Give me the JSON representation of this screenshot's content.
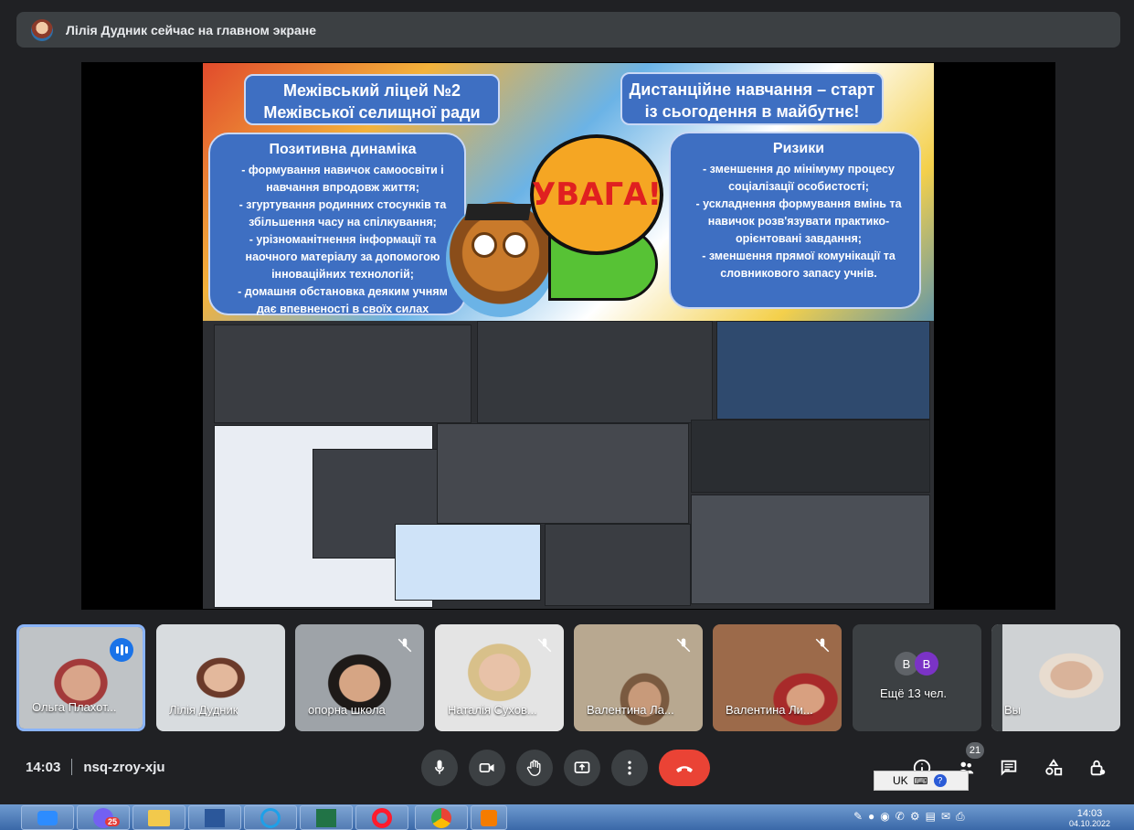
{
  "presenter_banner": {
    "text": "Лілія Дудник сейчас на главном экране"
  },
  "slide": {
    "title_left": "Межівський ліцей №2\nМежівської селищної ради",
    "title_right": "Дистанційне навчання – старт\nіз сьогодення в майбутнє!",
    "positive_heading": "Позитивна динаміка",
    "positive_text": "- формування навичок самоосвіти і навчання впродовж життя;\n- згуртування родинних стосунків та збільшення часу на спілкування;\n- урізноманітнення інформації та наочного матеріалу за допомогою інноваційних технологій;\n- домашня обстановка деяким учням дає впевненості в своїх силах",
    "uvaga": "УВАГА!",
    "risks_heading": "Ризики",
    "risks_text": "- зменшення до мінімуму процесу соціалізації особистості;\n- ускладнення формування вмінь та навичок розв'язувати практико-орієнтовані завдання;\n- зменшення прямої комунікації та словникового запасу учнів."
  },
  "participants": [
    {
      "name": "Ольга Плахот...",
      "speaking": true,
      "muted": false
    },
    {
      "name": "Лілія Дудник",
      "speaking": false,
      "muted": false
    },
    {
      "name": "опорна школа",
      "speaking": false,
      "muted": true
    },
    {
      "name": "Наталія Сухов...",
      "speaking": false,
      "muted": true
    },
    {
      "name": "Валентина Ла...",
      "speaking": false,
      "muted": true
    },
    {
      "name": "Валентина Ли...",
      "speaking": false,
      "muted": true
    }
  ],
  "more_tile": {
    "label": "Ещё 13 чел.",
    "initial_1": "В",
    "initial_2": "В"
  },
  "self_tile": {
    "name": "Вы"
  },
  "meeting": {
    "time": "14:03",
    "code": "nsq-zroy-xju"
  },
  "people_count": "21",
  "language_bar": {
    "lang": "UK"
  },
  "taskbar": {
    "clock_time": "14:03",
    "clock_date": "04.10.2022",
    "viber_badge": "25"
  },
  "colors": {
    "background": "#202124",
    "tile": "#3c4043",
    "accent_blue": "#8ab4f8",
    "hangup_red": "#ea4335",
    "slide_bubble": "#3e6fc2"
  }
}
